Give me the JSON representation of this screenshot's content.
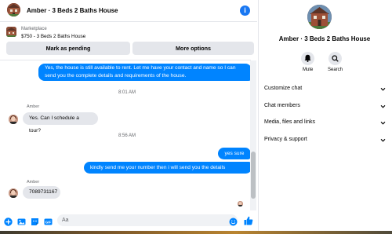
{
  "header": {
    "title": "Amber · 3 Beds 2 Baths House"
  },
  "marketplace": {
    "label": "Marketplace",
    "listing": "$750 - 3 Beds 2 Baths House",
    "mark_pending_label": "Mark as pending",
    "more_options_label": "More options"
  },
  "messages": [
    {
      "from": "me",
      "text": "Yes, the house is still available to rent. Let me have your contact and name so I can send you the complete details and requirements of the house."
    },
    {
      "timestamp": "8:01 AM"
    },
    {
      "from": "Amber",
      "sender_label": "Amber",
      "text": "Yes. Can I schedule a tour?"
    },
    {
      "timestamp": "8:56 AM"
    },
    {
      "from": "me",
      "text": "yes sure"
    },
    {
      "from": "me",
      "text": "kindly send me your number then i will send you the details"
    },
    {
      "from": "Amber",
      "sender_label": "Amber",
      "text": "7089731167"
    }
  ],
  "composer": {
    "placeholder": "Aa",
    "icons": [
      "plus-circle-icon",
      "photo-icon",
      "sticker-icon",
      "gif-icon",
      "emoji-icon",
      "thumbs-up-icon"
    ]
  },
  "info_panel": {
    "name": "Amber · 3 Beds 2 Baths House",
    "actions": [
      {
        "label": "Mute",
        "icon": "bell-icon"
      },
      {
        "label": "Search",
        "icon": "search-icon"
      }
    ],
    "sections": [
      {
        "label": "Customize chat"
      },
      {
        "label": "Chat members"
      },
      {
        "label": "Media, files and links"
      },
      {
        "label": "Privacy & support"
      }
    ]
  },
  "colors": {
    "accent": "#0084ff",
    "incoming_bubble": "#e4e6eb",
    "secondary_text": "#65676b",
    "info_icon": "#1877f2"
  }
}
